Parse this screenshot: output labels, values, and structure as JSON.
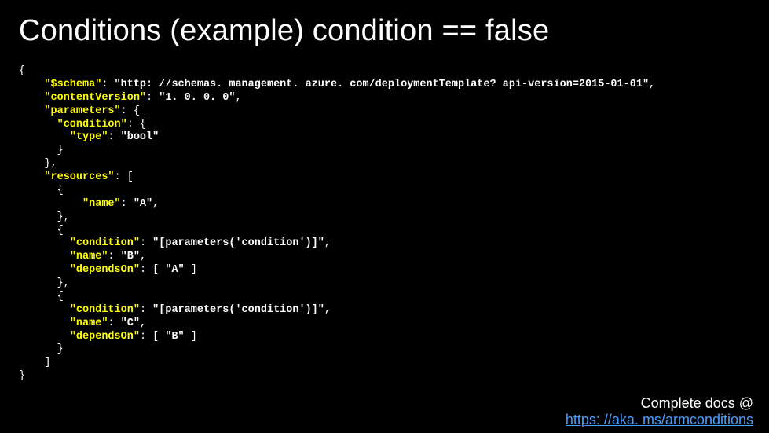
{
  "title": "Conditions  (example) condition == false",
  "code": {
    "l0": "{",
    "l1a": "\"$schema\"",
    "l1b": ": ",
    "l1c": "\"http: //schemas. management. azure. com/deploymentTemplate? api-version=2015-01-01\"",
    "l1d": ",",
    "l2a": "\"contentVersion\"",
    "l2b": ": ",
    "l2c": "\"1. 0. 0. 0\"",
    "l2d": ",",
    "l3a": "\"parameters\"",
    "l3b": ": {",
    "l4a": "\"condition\"",
    "l4b": ": {",
    "l5a": "\"type\"",
    "l5b": ": ",
    "l5c": "\"bool\"",
    "l6": "}",
    "l7": "},",
    "l8a": "\"resources\"",
    "l8b": ": [",
    "l9": "{",
    "l10a": "\"name\"",
    "l10b": ": ",
    "l10c": "\"A\"",
    "l10d": ",",
    "l11": "},",
    "l12": "{",
    "l13a": "\"condition\"",
    "l13b": ": ",
    "l13c": "\"[parameters('condition')]\"",
    "l13d": ",",
    "l14a": "\"name\"",
    "l14b": ": ",
    "l14c": "\"B\"",
    "l14d": ",",
    "l15a": "\"dependsOn\"",
    "l15b": ": [ ",
    "l15c": "\"A\"",
    "l15d": " ]",
    "l16": "},",
    "l17": "{",
    "l18a": "\"condition\"",
    "l18b": ": ",
    "l18c": "\"[parameters('condition')]\"",
    "l18d": ",",
    "l19a": "\"name\"",
    "l19b": ": ",
    "l19c": "\"C\"",
    "l19d": ",",
    "l20a": "\"dependsOn\"",
    "l20b": ": [ ",
    "l20c": "\"B\"",
    "l20d": " ]",
    "l21": "}",
    "l22": "]",
    "l23": "}"
  },
  "footer": {
    "docs": "Complete docs @",
    "link": "https: //aka. ms/armconditions"
  }
}
